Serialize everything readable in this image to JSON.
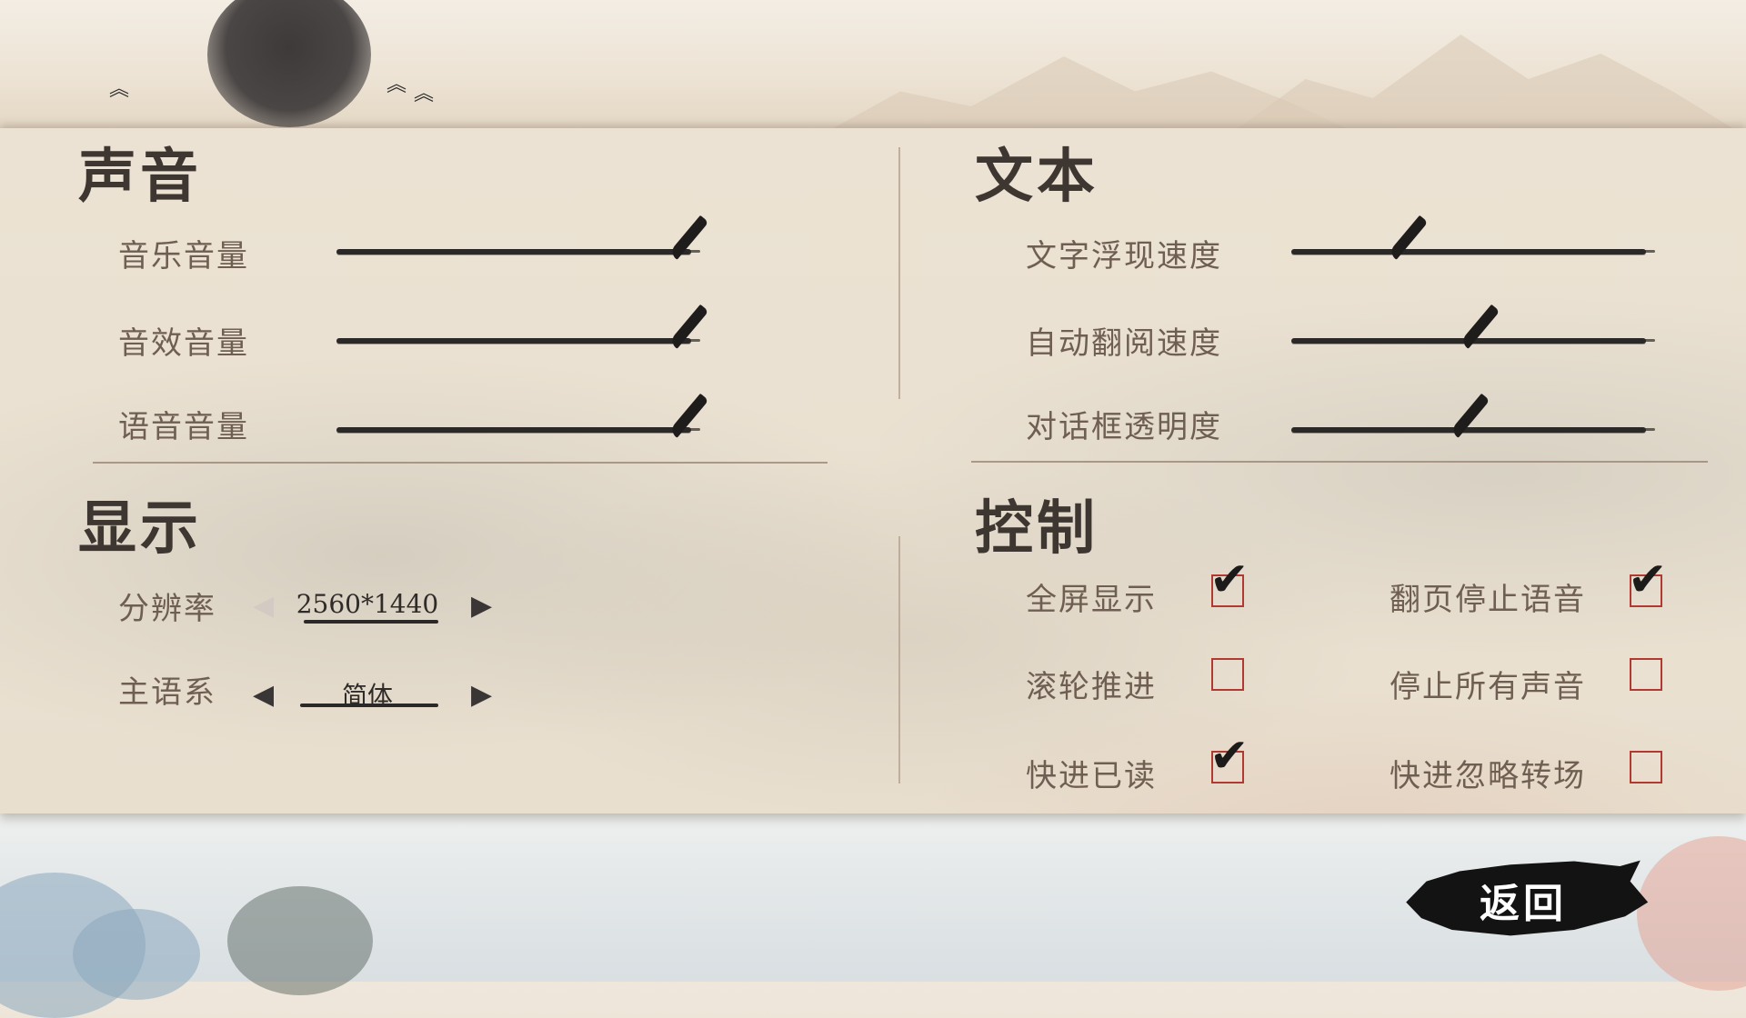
{
  "sections": {
    "sound": {
      "title": "声音",
      "items": [
        {
          "label": "音乐音量",
          "value": 1.0
        },
        {
          "label": "音效音量",
          "value": 1.0
        },
        {
          "label": "语音音量",
          "value": 1.0
        }
      ]
    },
    "text": {
      "title": "文本",
      "items": [
        {
          "label": "文字浮现速度",
          "value": 0.28
        },
        {
          "label": "自动翻阅速度",
          "value": 0.5
        },
        {
          "label": "对话框透明度",
          "value": 0.47
        }
      ]
    },
    "display": {
      "title": "显示",
      "resolution": {
        "label": "分辨率",
        "value": "2560*1440"
      },
      "language": {
        "label": "主语系",
        "value": "简体"
      }
    },
    "control": {
      "title": "控制",
      "options": [
        {
          "label": "全屏显示",
          "checked": true
        },
        {
          "label": "翻页停止语音",
          "checked": true
        },
        {
          "label": "滚轮推进",
          "checked": false
        },
        {
          "label": "停止所有声音",
          "checked": false
        },
        {
          "label": "快进已读",
          "checked": true
        },
        {
          "label": "快进忽略转场",
          "checked": false
        }
      ]
    }
  },
  "icons": {
    "arrow_left": "◀",
    "arrow_right": "▶",
    "check": "✔",
    "bird": "︽"
  },
  "back_button": {
    "label": "返回"
  },
  "colors": {
    "ink": "#2b2928",
    "checkbox_border": "#b03a32",
    "label": "#6f5f52",
    "heading": "#3e3631"
  }
}
